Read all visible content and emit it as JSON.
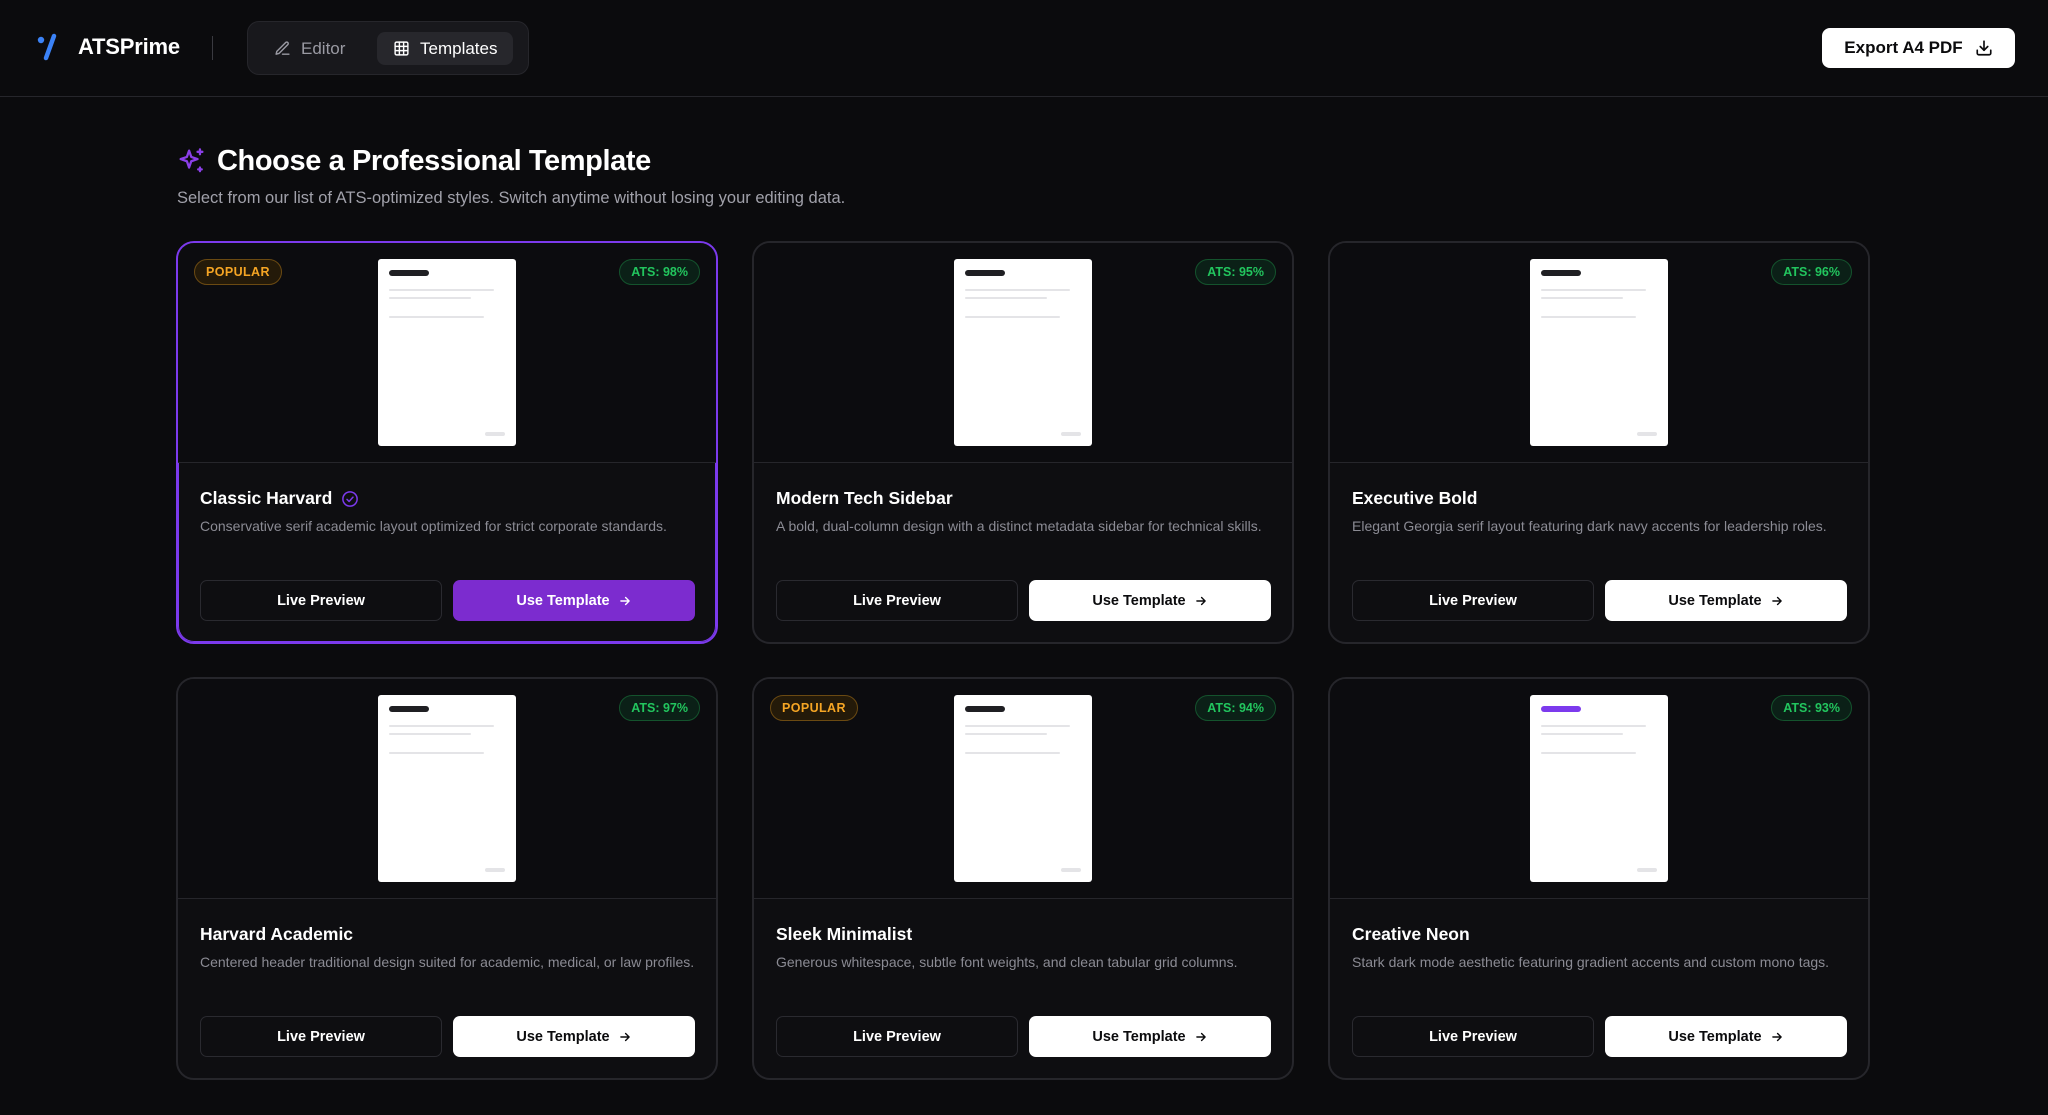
{
  "app": {
    "name": "ATSPrime"
  },
  "nav": {
    "editor_label": "Editor",
    "templates_label": "Templates",
    "active": "templates"
  },
  "export": {
    "label": "Export A4 PDF"
  },
  "heading": {
    "title": "Choose a Professional Template",
    "subtitle": "Select from our list of ATS-optimized styles. Switch anytime without losing your editing data."
  },
  "card_labels": {
    "preview": "Live Preview",
    "use": "Use Template"
  },
  "templates": [
    {
      "name": "Classic Harvard",
      "description": "Conservative serif academic layout optimized for strict corporate standards.",
      "ats": "ATS: 98%",
      "popular": "POPULAR",
      "selected": true
    },
    {
      "name": "Modern Tech Sidebar",
      "description": "A bold, dual-column design with a distinct metadata sidebar for technical skills.",
      "ats": "ATS: 95%"
    },
    {
      "name": "Executive Bold",
      "description": "Elegant Georgia serif layout featuring dark navy accents for leadership roles.",
      "ats": "ATS: 96%"
    },
    {
      "name": "Harvard Academic",
      "description": "Centered header traditional design suited for academic, medical, or law profiles.",
      "ats": "ATS: 97%"
    },
    {
      "name": "Sleek Minimalist",
      "description": "Generous whitespace, subtle font weights, and clean tabular grid columns.",
      "ats": "ATS: 94%",
      "popular": "POPULAR"
    },
    {
      "name": "Creative Neon",
      "description": "Stark dark mode aesthetic featuring gradient accents and custom mono tags.",
      "ats": "ATS: 93%",
      "accent": true
    }
  ],
  "colors": {
    "accent": "#7c3aed",
    "background": "#0b0b0d",
    "popular": "#f5a524",
    "ats": "#22c55e"
  },
  "icons": {
    "logo": "brand-slash-icon",
    "editor": "pencil-icon",
    "templates": "grid-icon",
    "export": "download-icon",
    "heading": "sparkle-icon",
    "selected": "check-circle-icon",
    "use": "arrow-right-icon"
  }
}
